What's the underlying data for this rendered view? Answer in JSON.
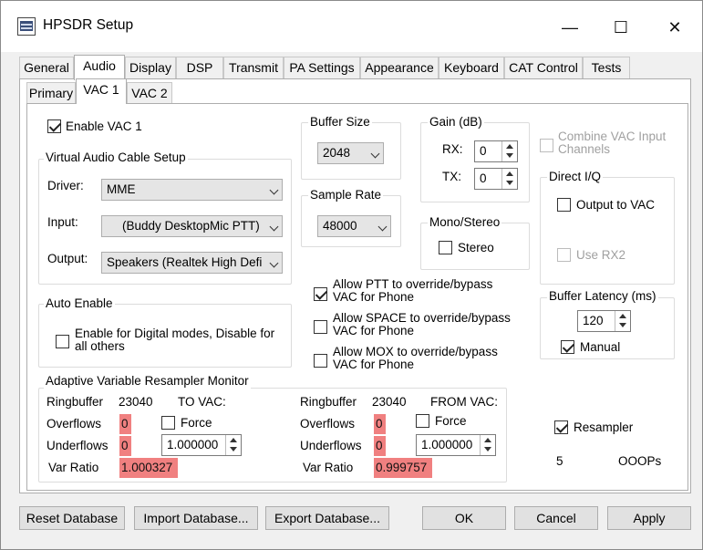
{
  "window": {
    "title": "HPSDR Setup",
    "minimize": "—",
    "maximize": "☐",
    "close": "✕"
  },
  "tabs": [
    "General",
    "Audio",
    "Display",
    "DSP",
    "Transmit",
    "PA Settings",
    "Appearance",
    "Keyboard",
    "CAT Control",
    "Tests"
  ],
  "subtabs": [
    "Primary",
    "VAC 1",
    "VAC 2"
  ],
  "vac": {
    "enable_label": "Enable VAC 1",
    "setup_group": "Virtual Audio Cable Setup",
    "driver_label": "Driver:",
    "driver_value": "MME",
    "input_label": "Input:",
    "input_value": "(Buddy DesktopMic PTT)",
    "output_label": "Output:",
    "output_value": "Speakers (Realtek High Defi",
    "buffer_group": "Buffer Size",
    "buffer_value": "2048",
    "rate_group": "Sample Rate",
    "rate_value": "48000",
    "gain_group": "Gain (dB)",
    "rx_label": "RX:",
    "rx_value": "0",
    "tx_label": "TX:",
    "tx_value": "0",
    "mono_group": "Mono/Stereo",
    "stereo_label": "Stereo",
    "combine_label": "Combine VAC Input Channels",
    "direct_group": "Direct I/Q",
    "output_vac_label": "Output to VAC",
    "use_rx2_label": "Use RX2",
    "latency_group": "Buffer Latency (ms)",
    "latency_value": "120",
    "manual_label": "Manual",
    "auto_group": "Auto Enable",
    "auto_label": "Enable for Digital modes, Disable for all others",
    "ptt_label": "Allow PTT to override/bypass VAC for Phone",
    "space_label": "Allow SPACE to override/bypass VAC for Phone",
    "mox_label": "Allow MOX to override/bypass VAC for Phone"
  },
  "monitor": {
    "group": "Adaptive Variable Resampler Monitor",
    "ringbuffer_label": "Ringbuffer",
    "overflows_label": "Overflows",
    "underflows_label": "Underflows",
    "varratio_label": "Var Ratio",
    "to": {
      "ringbuffer": "23040",
      "direction": "TO VAC:",
      "overflows": "0",
      "underflows": "0",
      "varratio": "1.000327",
      "force_label": "Force",
      "force_value": "1.000000"
    },
    "from": {
      "ringbuffer": "23040",
      "direction": "FROM VAC:",
      "overflows": "0",
      "underflows": "0",
      "varratio": "0.999757",
      "force_label": "Force",
      "force_value": "1.000000"
    },
    "resampler_label": "Resampler",
    "ooops_count": "5",
    "ooops_label": "OOOPs"
  },
  "buttons": {
    "reset": "Reset Database",
    "import": "Import Database...",
    "export": "Export Database...",
    "ok": "OK",
    "cancel": "Cancel",
    "apply": "Apply"
  }
}
